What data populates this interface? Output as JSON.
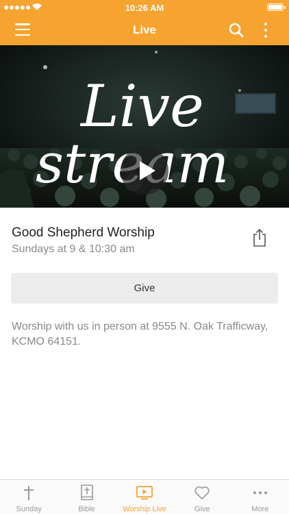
{
  "status_bar": {
    "time": "10:26 AM"
  },
  "nav": {
    "title": "Live"
  },
  "hero": {
    "script_line1": "Live",
    "script_line2": "stream"
  },
  "info": {
    "title": "Good Shepherd Worship",
    "subtitle": "Sundays at 9 & 10:30 am"
  },
  "give_button": {
    "label": "Give"
  },
  "description": "Worship with us in person at 9555 N. Oak Trafficway, KCMO 64151.",
  "tabs": [
    {
      "label": "Sunday",
      "icon": "cross-icon",
      "active": false
    },
    {
      "label": "Bible",
      "icon": "bible-icon",
      "active": false
    },
    {
      "label": "Worship Live",
      "icon": "tv-play-icon",
      "active": true
    },
    {
      "label": "Give",
      "icon": "heart-icon",
      "active": false
    },
    {
      "label": "More",
      "icon": "more-dots-icon",
      "active": false
    }
  ],
  "colors": {
    "accent": "#f7a330",
    "inactive": "#999999"
  }
}
